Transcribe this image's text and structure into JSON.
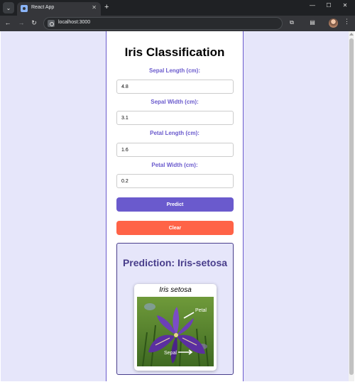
{
  "browser": {
    "tab_title": "React App",
    "tab_close": "✕",
    "new_tab": "+",
    "url": "localhost:3000",
    "window": {
      "minimize": "—",
      "maximize": "☐",
      "close": "✕"
    },
    "nav": {
      "back": "←",
      "forward": "→",
      "reload": "↻"
    }
  },
  "app": {
    "title": "Iris Classification",
    "fields": [
      {
        "label": "Sepal Length (cm):",
        "value": "4.8"
      },
      {
        "label": "Sepal Width (cm):",
        "value": "3.1"
      },
      {
        "label": "Petal Length (cm):",
        "value": "1.6"
      },
      {
        "label": "Petal Width (cm):",
        "value": "0.2"
      }
    ],
    "predict_label": "Predict",
    "clear_label": "Clear",
    "result": {
      "title": "Prediction: Iris-setosa",
      "species": "Iris setosa",
      "image_labels": {
        "petal": "Petal",
        "sepal": "Sepal"
      }
    }
  },
  "colors": {
    "page_bg": "#e6e6fa",
    "accent": "#6a5acd",
    "clear": "#ff6347",
    "result_text": "#483d8b"
  }
}
